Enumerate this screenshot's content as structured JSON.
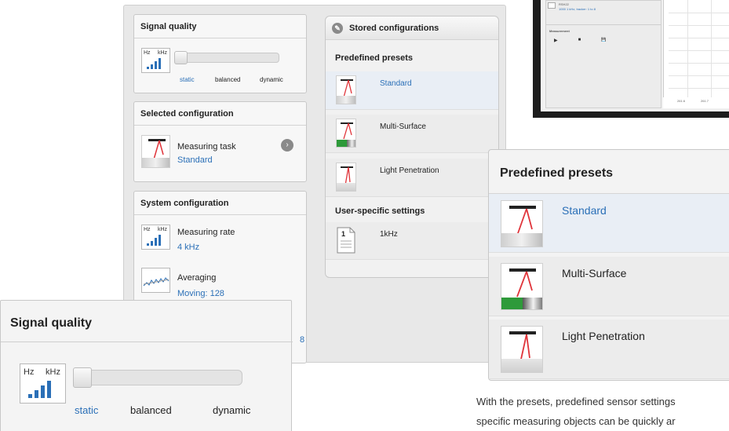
{
  "software_shot": {
    "line1": "RSH22",
    "line2": "1000 1 kHz, tracker: 1 to 8",
    "section": "Measurement",
    "play": "▶",
    "stop": "■",
    "save": "💾",
    "ticks": [
      "261.6",
      "261.7"
    ]
  },
  "signal_quality": {
    "title": "Signal quality",
    "icon_hz": "Hz",
    "icon_khz": "kHz",
    "static": "static",
    "balanced": "balanced",
    "dynamic": "dynamic",
    "level": 0
  },
  "selected_configuration": {
    "title": "Selected configuration",
    "task_label": "Measuring task",
    "task_value": "Standard"
  },
  "system_configuration": {
    "title": "System configuration",
    "rate_label": "Measuring rate",
    "rate_value": "4 kHz",
    "avg_label": "Averaging",
    "avg_value": "Moving: 128",
    "partial_digit": "8"
  },
  "stored_configurations": {
    "title": "Stored configurations",
    "predefined_title": "Predefined presets",
    "presets": [
      "Standard",
      "Multi-Surface",
      "Light Penetration"
    ],
    "user_title": "User-specific settings",
    "user_item": "1kHz",
    "doc_number": "1"
  },
  "zoom_presets": {
    "title": "Predefined presets",
    "presets": [
      "Standard",
      "Multi-Surface",
      "Light Penetration"
    ]
  },
  "zoom_signal": {
    "title": "Signal quality",
    "icon_hz": "Hz",
    "icon_khz": "kHz",
    "static": "static",
    "balanced": "balanced",
    "dynamic": "dynamic"
  },
  "caption": {
    "line1": "With the presets, predefined sensor settings",
    "line2": "specific measuring objects can be quickly ar"
  },
  "colors": {
    "accent_blue": "#2a6fb7",
    "green": "#2e9a3a",
    "laser_red": "#e0343a"
  }
}
